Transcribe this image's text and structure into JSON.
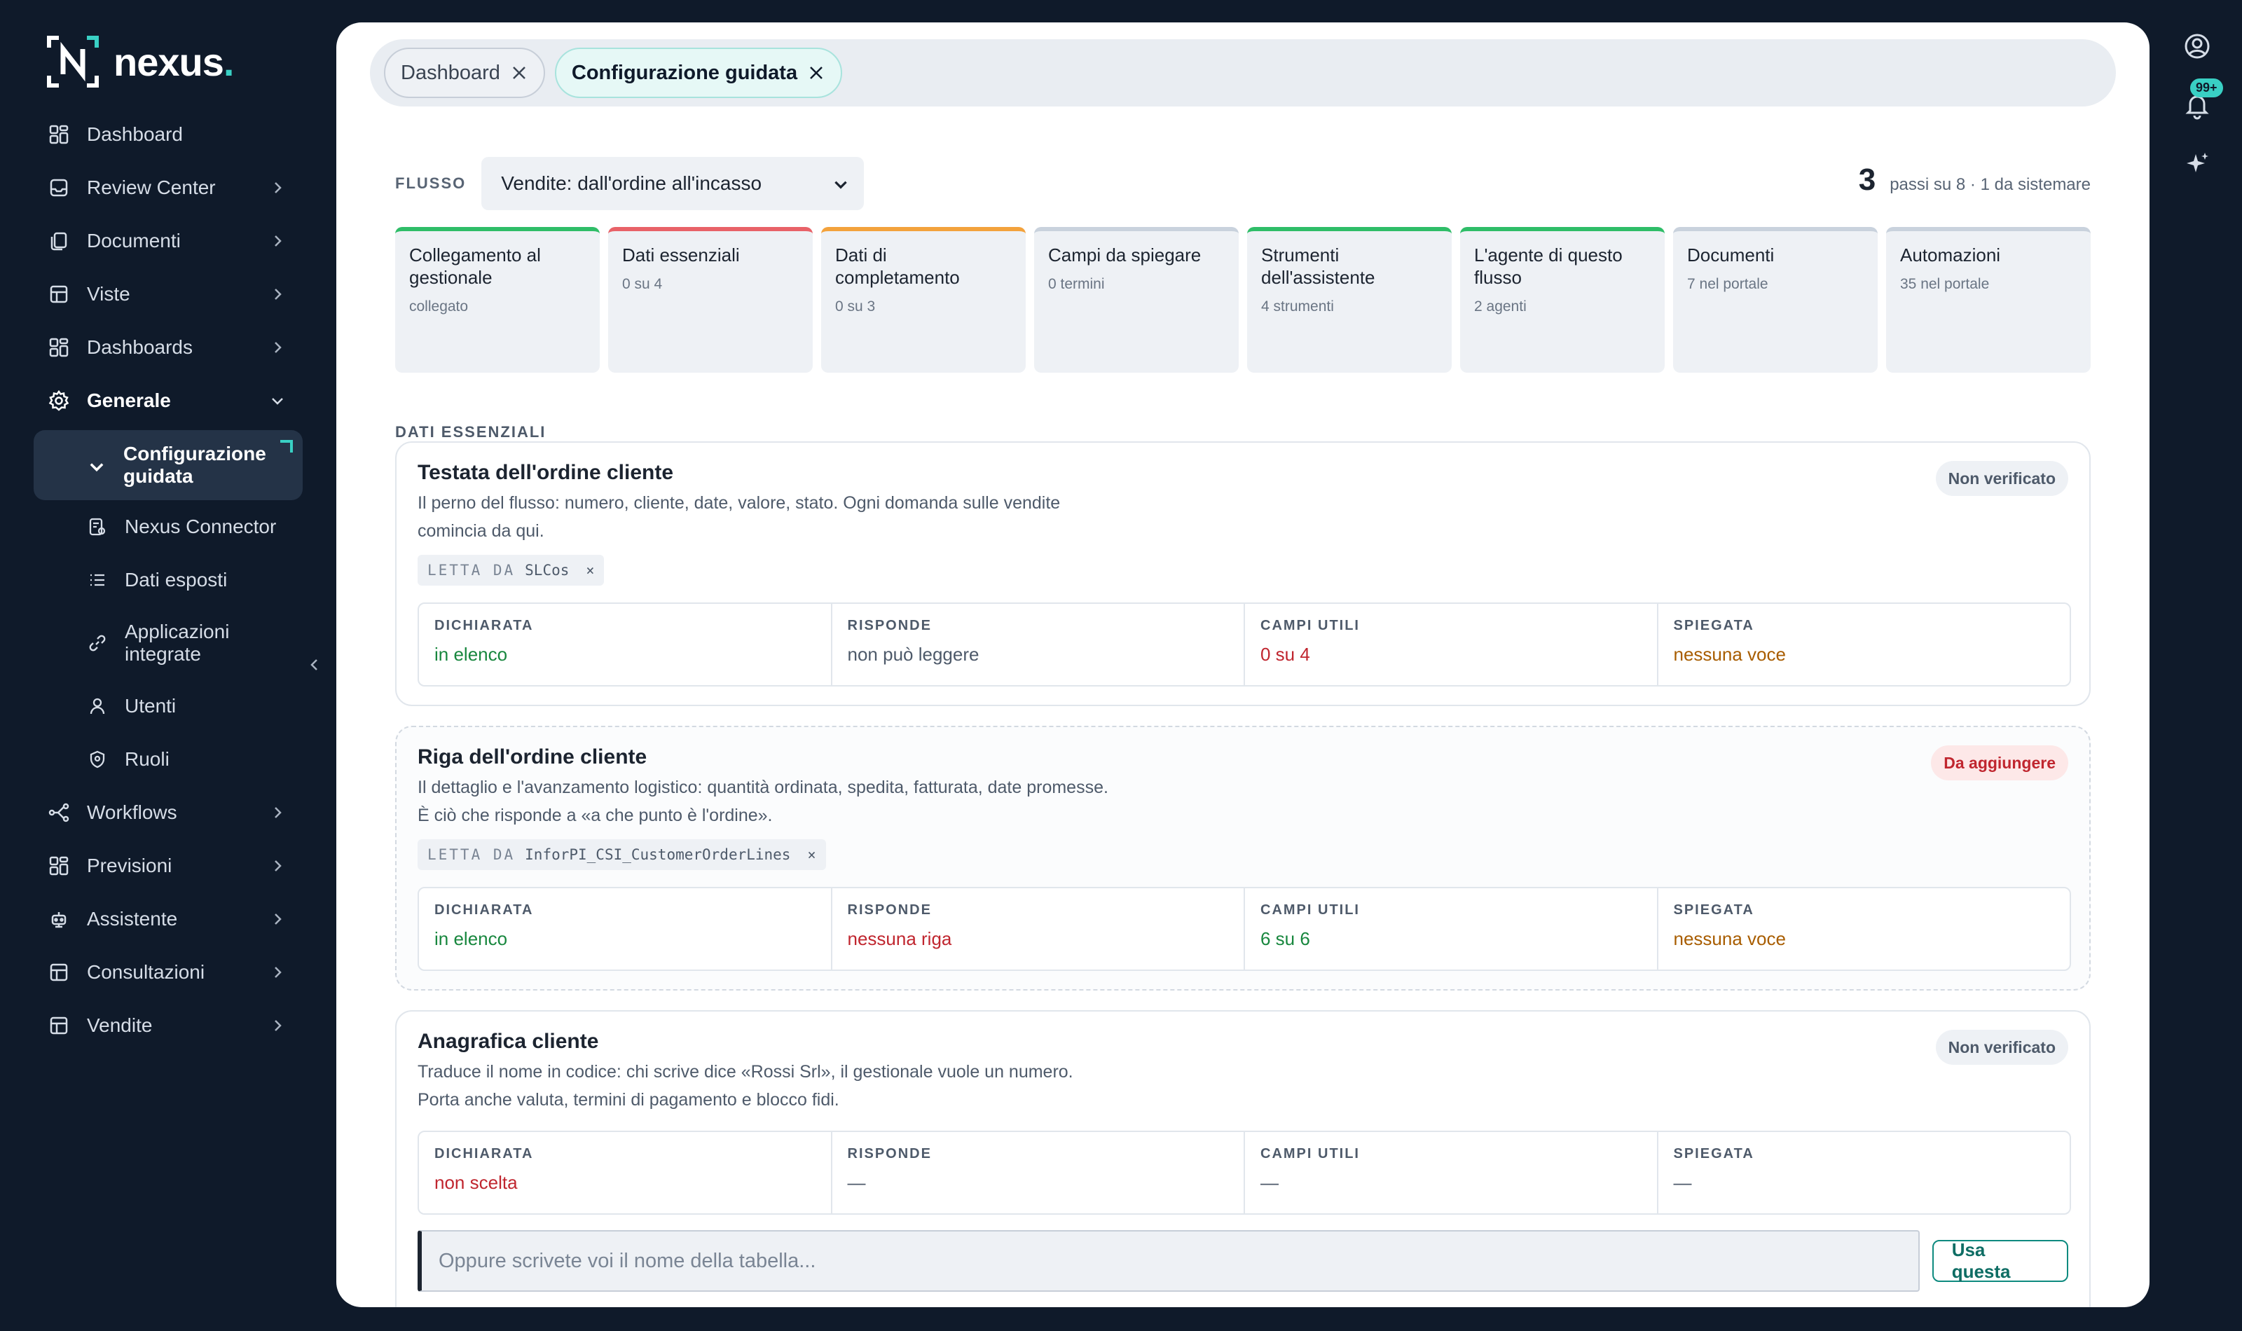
{
  "brand": {
    "name": "nexus",
    "dot": ".",
    "accent": "#39d0c4"
  },
  "sidebar": {
    "items": [
      {
        "label": "Dashboard",
        "icon": "dashboard-icon"
      },
      {
        "label": "Review Center",
        "icon": "inbox-icon"
      },
      {
        "label": "Documenti",
        "icon": "documents-icon"
      },
      {
        "label": "Viste",
        "icon": "table-icon"
      },
      {
        "label": "Dashboards",
        "icon": "dashboard-icon"
      },
      {
        "label": "Generale",
        "icon": "gear-icon"
      }
    ],
    "active": "Configurazione guidata",
    "sub": [
      {
        "label": "Nexus Connector"
      },
      {
        "label": "Dati esposti"
      },
      {
        "label": "Applicazioni integrate"
      },
      {
        "label": "Utenti"
      },
      {
        "label": "Ruoli"
      }
    ],
    "items2": [
      {
        "label": "Workflows"
      },
      {
        "label": "Previsioni"
      },
      {
        "label": "Assistente"
      },
      {
        "label": "Consultazioni"
      },
      {
        "label": "Vendite"
      }
    ]
  },
  "rail": {
    "notifications_badge": "99+"
  },
  "tabs": [
    {
      "label": "Dashboard"
    },
    {
      "label": "Configurazione guidata"
    }
  ],
  "flow": {
    "label": "FLUSSO",
    "selected": "Vendite: dall'ordine all'incasso",
    "progress_num": "3",
    "progress_text": "passi su 8 · 1 da sistemare"
  },
  "steps": [
    {
      "title": "Collegamento al gestionale",
      "sub": "collegato",
      "state": "green"
    },
    {
      "title": "Dati essenziali",
      "sub": "0 su 4",
      "state": "red"
    },
    {
      "title": "Dati di completamento",
      "sub": "0 su 3",
      "state": "orange"
    },
    {
      "title": "Campi da spiegare",
      "sub": "0 termini",
      "state": "grey"
    },
    {
      "title": "Strumenti dell'assistente",
      "sub": "4 strumenti",
      "state": "green"
    },
    {
      "title": "L'agente di questo flusso",
      "sub": "2 agenti",
      "state": "green"
    },
    {
      "title": "Documenti",
      "sub": "7 nel portale",
      "state": "grey"
    },
    {
      "title": "Automazioni",
      "sub": "35 nel portale",
      "state": "grey"
    }
  ],
  "section_title": "DATI ESSENZIALI",
  "cols": {
    "c1": "DICHIARATA",
    "c2": "RISPONDE",
    "c3": "CAMPI UTILI",
    "c4": "SPIEGATA"
  },
  "cards": [
    {
      "title": "Testata dell'ordine cliente",
      "desc": "Il perno del flusso: numero, cliente, date, valore, stato. Ogni domanda sulle vendite comincia da qui.",
      "status": "Non verificato",
      "chip_prefix": "LETTA DA",
      "chip_value": "SLCos",
      "chip_close": "×",
      "v1": "in elenco",
      "v2": "non può leggere",
      "v3": "0 su 4",
      "v4": "nessuna voce"
    },
    {
      "title": "Riga dell'ordine cliente",
      "desc": "Il dettaglio e l'avanzamento logistico: quantità ordinata, spedita, fatturata, date promesse. È ciò che risponde a «a che punto è l'ordine».",
      "status": "Da aggiungere",
      "chip_prefix": "LETTA DA",
      "chip_value": "InforPI_CSI_CustomerOrderLines",
      "chip_close": "×",
      "v1": "in elenco",
      "v2": "nessuna riga",
      "v3": "6 su 6",
      "v4": "nessuna voce"
    },
    {
      "title": "Anagrafica cliente",
      "desc": "Traduce il nome in codice: chi scrive dice «Rossi Srl», il gestionale vuole un numero. Porta anche valuta, termini di pagamento e blocco fidi.",
      "status": "Non verificato",
      "v1": "non scelta",
      "v2": "—",
      "v3": "—",
      "v4": "—",
      "input_placeholder": "Oppure scrivete voi il nome della tabella...",
      "button": "Usa questa"
    }
  ]
}
